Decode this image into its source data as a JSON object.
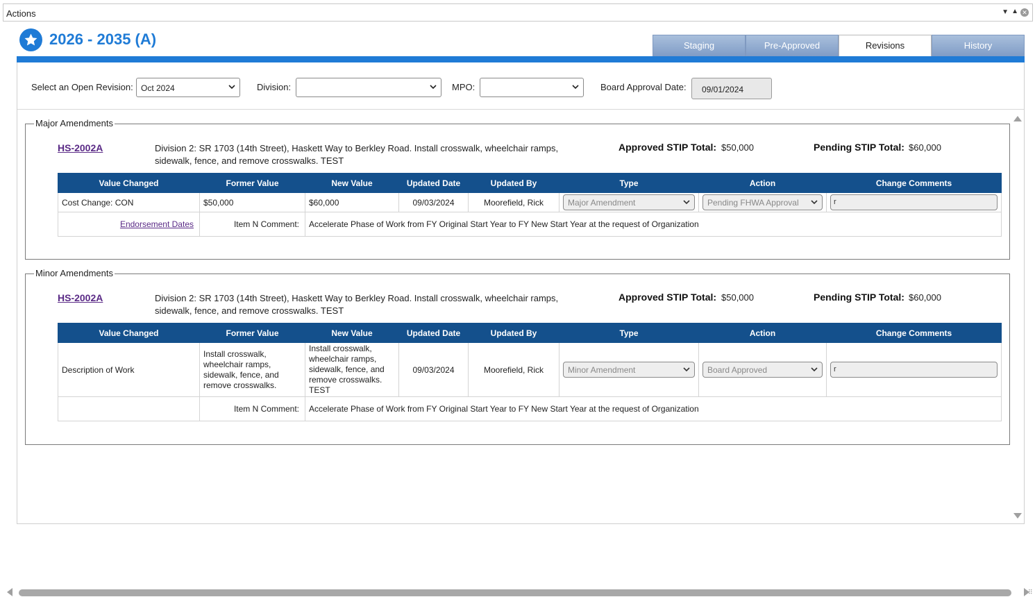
{
  "window": {
    "title": "Actions"
  },
  "header": {
    "title": "2026 - 2035 (A)",
    "tabs": [
      {
        "label": "Staging",
        "active": false
      },
      {
        "label": "Pre-Approved",
        "active": false
      },
      {
        "label": "Revisions",
        "active": true
      },
      {
        "label": "History",
        "active": false
      }
    ]
  },
  "filters": {
    "revision_label": "Select an Open Revision:",
    "revision_value": "Oct 2024",
    "division_label": "Division:",
    "division_value": "",
    "mpo_label": "MPO:",
    "mpo_value": "",
    "board_date_label": "Board Approval Date:",
    "board_date_value": "09/01/2024"
  },
  "columns": [
    "Value Changed",
    "Former Value",
    "New Value",
    "Updated Date",
    "Updated By",
    "Type",
    "Action",
    "Change Comments"
  ],
  "major": {
    "legend": "Major Amendments",
    "project_id": "HS-2002A",
    "description": "Division 2: SR 1703 (14th Street), Haskett Way to Berkley Road. Install crosswalk, wheelchair ramps, sidewalk, fence, and remove crosswalks. TEST",
    "approved_label": "Approved STIP Total:",
    "approved_value": "$50,000",
    "pending_label": "Pending STIP Total:",
    "pending_value": "$60,000",
    "row": {
      "value_changed": "Cost Change: CON",
      "former_value": "$50,000",
      "new_value": "$60,000",
      "updated_date": "09/03/2024",
      "updated_by": "Moorefield, Rick",
      "type": "Major Amendment",
      "action": "Pending FHWA Approval",
      "comment": "r"
    },
    "endorsement_link": "Endorsement Dates",
    "item_comment_label": "Item N Comment:",
    "item_comment": "Accelerate Phase of Work from FY Original Start Year to FY New Start Year at the request of Organization"
  },
  "minor": {
    "legend": "Minor Amendments",
    "project_id": "HS-2002A",
    "description": "Division 2: SR 1703 (14th Street), Haskett Way to Berkley Road. Install crosswalk, wheelchair ramps, sidewalk, fence, and remove crosswalks. TEST",
    "approved_label": "Approved STIP Total:",
    "approved_value": "$50,000",
    "pending_label": "Pending STIP Total:",
    "pending_value": "$60,000",
    "row": {
      "value_changed": "Description of Work",
      "former_value": "Install crosswalk, wheelchair ramps, sidewalk, fence, and remove crosswalks.",
      "new_value": "Install crosswalk, wheelchair ramps, sidewalk, fence, and remove crosswalks. TEST",
      "updated_date": "09/03/2024",
      "updated_by": "Moorefield, Rick",
      "type": "Minor Amendment",
      "action": "Board Approved",
      "comment": "r"
    },
    "item_comment_label": "Item N Comment:",
    "item_comment": "Accelerate Phase of Work from FY Original Start Year to FY New Start Year at the request of Organization"
  },
  "colors": {
    "accent": "#1f7bd6",
    "table_header": "#14508c",
    "link": "#5a2a86"
  }
}
